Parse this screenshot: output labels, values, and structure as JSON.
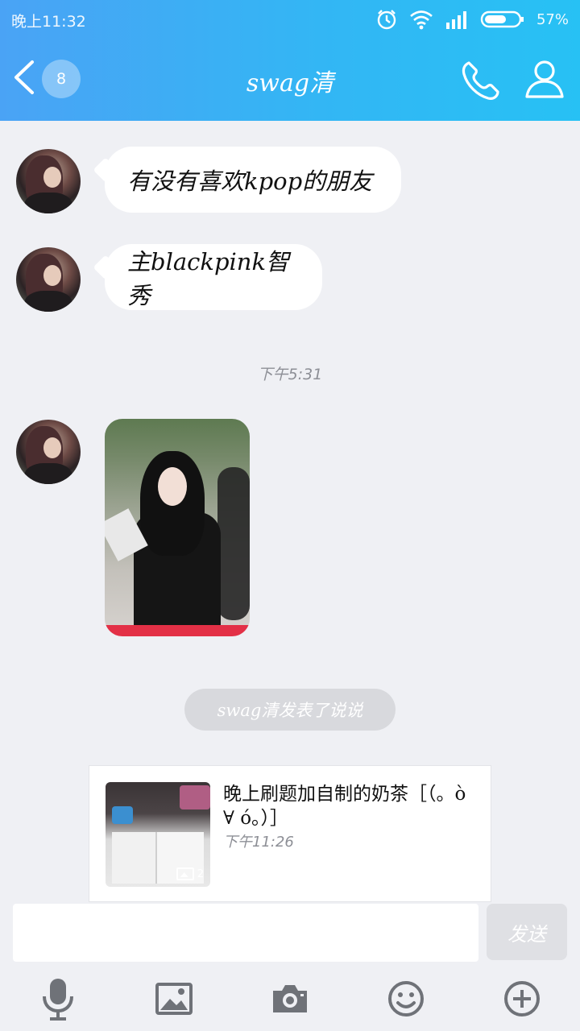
{
  "status_bar": {
    "time": "晚上11:32",
    "battery": "57%",
    "icons": [
      "alarm-icon",
      "wifi-icon",
      "signal-icon",
      "battery-icon"
    ]
  },
  "header": {
    "title": "swag清",
    "unread_count": "8",
    "icons": [
      "back-arrow-icon",
      "phone-icon",
      "profile-icon"
    ]
  },
  "messages": [
    {
      "type": "text",
      "text": "有没有喜欢kpop的朋友"
    },
    {
      "type": "text",
      "text": "主blackpink智秀"
    },
    {
      "type": "image"
    }
  ],
  "timestamp": "下午5:31",
  "system_notice": "swag清发表了说说",
  "status_card": {
    "title": "晚上刷题加自制的奶茶［（。ò ∀ ó。）］",
    "time": "下午11:26",
    "image_count": "2"
  },
  "input": {
    "placeholder": "",
    "send_label": "发送"
  },
  "toolbar": [
    "microphone-icon",
    "image-icon",
    "camera-icon",
    "emoji-icon",
    "plus-icon"
  ],
  "colors": {
    "header_start": "#4aa3f5",
    "header_end": "#27c1f4",
    "background": "#eff0f4",
    "bubble": "#ffffff",
    "toolbar_icon": "#6f7278"
  }
}
